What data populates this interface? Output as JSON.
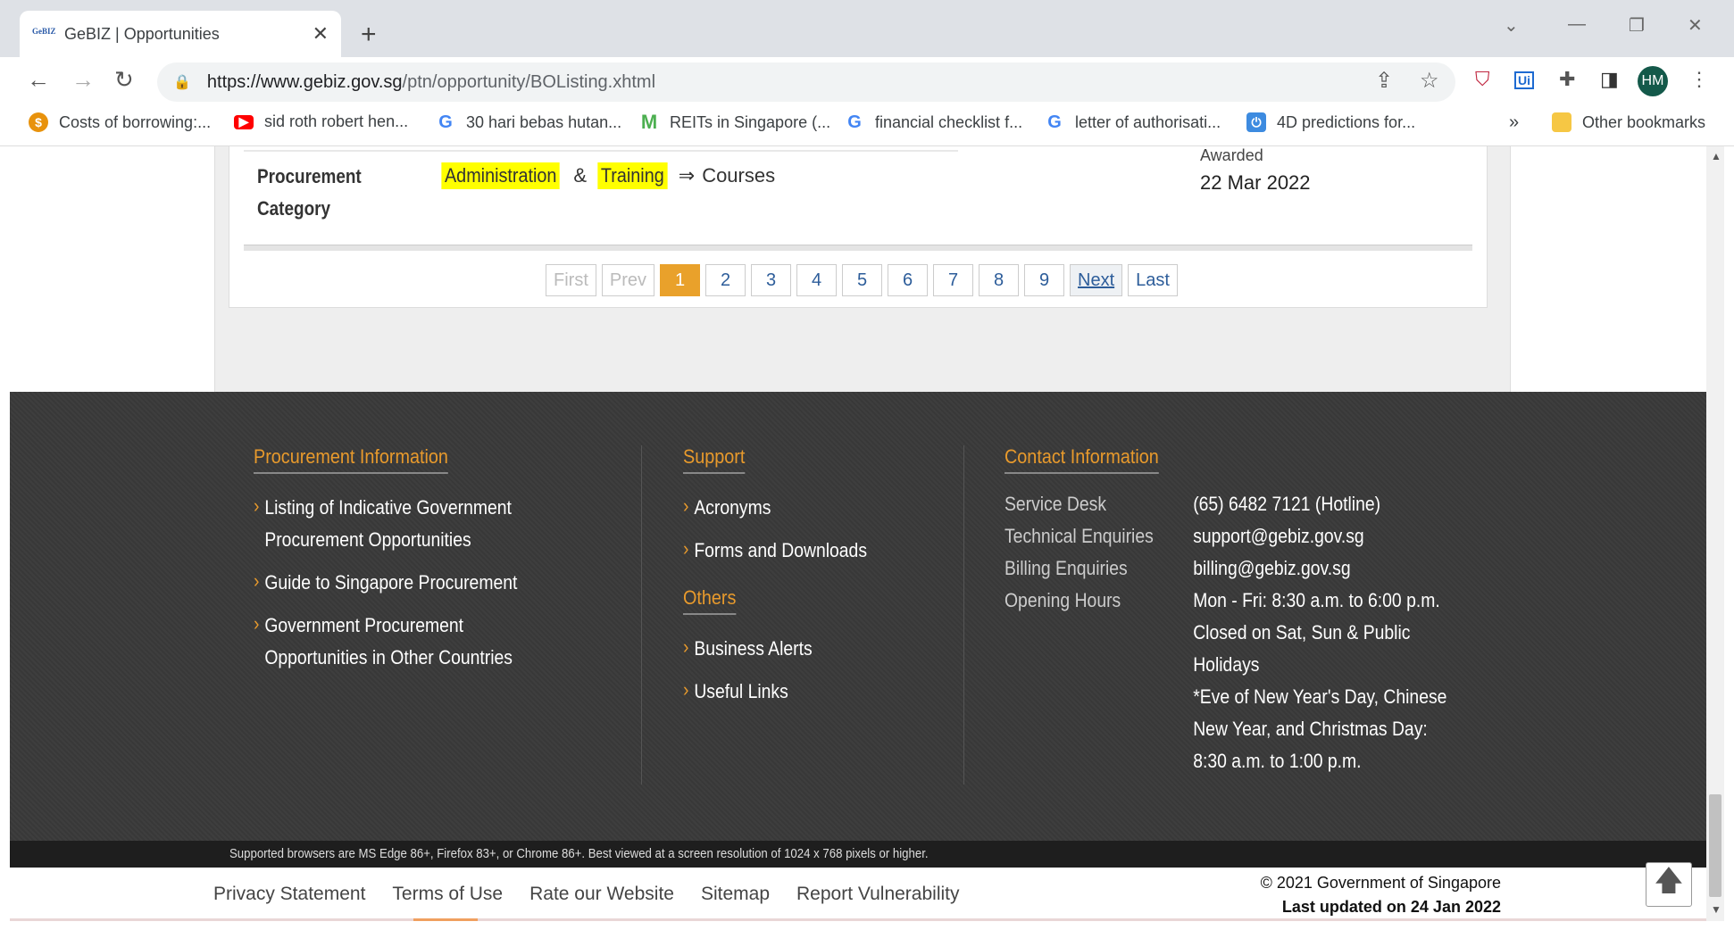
{
  "browser": {
    "tab_title": "GeBIZ | Opportunities",
    "favicon_text": "GeBIZ",
    "url_domain": "https://www.gebiz.gov.sg",
    "url_path": "/ptn/opportunity/BOListing.xhtml",
    "profile_initials": "HM",
    "bookmarks": [
      "Costs of borrowing:...",
      "sid roth robert hen...",
      "30 hari bebas hutan...",
      "REITs in Singapore (...",
      "financial checklist f...",
      "letter of authorisati...",
      "4D predictions for..."
    ],
    "other_bookmarks": "Other bookmarks"
  },
  "listing": {
    "procurement_label_1": "Procurement",
    "procurement_label_2": "Category",
    "category_1": "Administration",
    "amp": "&",
    "category_2": "Training",
    "arrow": "⇒",
    "subcategory": "Courses",
    "awarded_label": "Awarded",
    "awarded_date": "22 Mar 2022"
  },
  "pager": {
    "first": "First",
    "prev": "Prev",
    "pages": [
      "1",
      "2",
      "3",
      "4",
      "5",
      "6",
      "7",
      "8",
      "9"
    ],
    "current": "1",
    "next": "Next",
    "last": "Last"
  },
  "footer": {
    "procurement_info": {
      "heading": "Procurement Information",
      "links": [
        "Listing of Indicative Government",
        "Procurement Opportunities",
        "Guide to Singapore Procurement",
        "Government Procurement",
        "Opportunities in Other Countries"
      ]
    },
    "support": {
      "heading": "Support",
      "links": [
        "Acronyms",
        "Forms and Downloads"
      ]
    },
    "others": {
      "heading": "Others",
      "links": [
        "Business Alerts",
        "Useful Links"
      ]
    },
    "contact": {
      "heading": "Contact Information",
      "rows": [
        {
          "key": "Service Desk",
          "value": "(65) 6482 7121 (Hotline)"
        },
        {
          "key": "Technical Enquiries",
          "value": "support@gebiz.gov.sg"
        },
        {
          "key": "Billing Enquiries",
          "value": "billing@gebiz.gov.sg"
        },
        {
          "key": "Opening Hours",
          "value": "Mon - Fri: 8:30 a.m. to 6:00 p.m."
        }
      ],
      "hours_line_2": "Closed on Sat, Sun & Public",
      "hours_line_3": "Holidays",
      "note_1": "*Eve of New Year's Day, Chinese",
      "note_2": "New Year, and Christmas Day:",
      "note_3": "8:30 a.m. to 1:00 p.m."
    },
    "supported_browsers": "Supported browsers are MS Edge 86+, Firefox 83+, or Chrome 86+. Best viewed at a screen resolution of 1024 x 768 pixels or higher.",
    "bottom_links": [
      "Privacy Statement",
      "Terms of Use",
      "Rate our Website",
      "Sitemap",
      "Report Vulnerability"
    ],
    "copyright": "© 2021 Government of Singapore",
    "last_updated": "Last updated on 24 Jan 2022"
  }
}
